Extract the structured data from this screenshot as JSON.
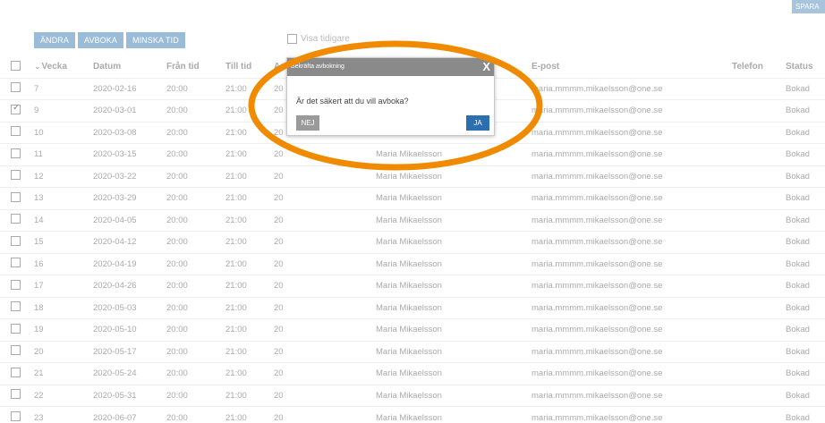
{
  "top_button": "SPARA",
  "toolbar": {
    "change": "ÄNDRA",
    "cancel": "AVBOKA",
    "reduce": "MINSKA TID"
  },
  "show_checkbox": {
    "label": "Visa tidigare"
  },
  "columns": {
    "vecka": "Vecka",
    "datum": "Datum",
    "fran": "Från tid",
    "till": "Till tid",
    "antal": "Ant",
    "namn": "",
    "epost": "E-post",
    "telefon": "Telefon",
    "status": "Status"
  },
  "rows": [
    {
      "vecka": "7",
      "datum": "2020-02-16",
      "fran": "20:00",
      "till": "21:00",
      "antal": "20",
      "namn": "",
      "epost": "maria.mmmm.mikaelsson@one.se",
      "status": "Bokad",
      "checked": false
    },
    {
      "vecka": "9",
      "datum": "2020-03-01",
      "fran": "20:00",
      "till": "21:00",
      "antal": "20",
      "namn": "",
      "epost": "maria.mmmm.mikaelsson@one.se",
      "status": "Bokad",
      "checked": true
    },
    {
      "vecka": "10",
      "datum": "2020-03-08",
      "fran": "20:00",
      "till": "21:00",
      "antal": "20",
      "namn": "",
      "epost": "maria.mmmm.mikaelsson@one.se",
      "status": "Bokad",
      "checked": false
    },
    {
      "vecka": "11",
      "datum": "2020-03-15",
      "fran": "20:00",
      "till": "21:00",
      "antal": "20",
      "namn": "Maria Mikaelsson",
      "epost": "maria.mmmm.mikaelsson@one.se",
      "status": "Bokad",
      "checked": false
    },
    {
      "vecka": "12",
      "datum": "2020-03-22",
      "fran": "20:00",
      "till": "21:00",
      "antal": "20",
      "namn": "Maria Mikaelsson",
      "epost": "maria.mmmm.mikaelsson@one.se",
      "status": "Bokad",
      "checked": false
    },
    {
      "vecka": "13",
      "datum": "2020-03-29",
      "fran": "20:00",
      "till": "21:00",
      "antal": "20",
      "namn": "Maria Mikaelsson",
      "epost": "maria.mmmm.mikaelsson@one.se",
      "status": "Bokad",
      "checked": false
    },
    {
      "vecka": "14",
      "datum": "2020-04-05",
      "fran": "20:00",
      "till": "21:00",
      "antal": "20",
      "namn": "Maria Mikaelsson",
      "epost": "maria.mmmm.mikaelsson@one.se",
      "status": "Bokad",
      "checked": false
    },
    {
      "vecka": "15",
      "datum": "2020-04-12",
      "fran": "20:00",
      "till": "21:00",
      "antal": "20",
      "namn": "Maria Mikaelsson",
      "epost": "maria.mmmm.mikaelsson@one.se",
      "status": "Bokad",
      "checked": false
    },
    {
      "vecka": "16",
      "datum": "2020-04-19",
      "fran": "20:00",
      "till": "21:00",
      "antal": "20",
      "namn": "Maria Mikaelsson",
      "epost": "maria.mmmm.mikaelsson@one.se",
      "status": "Bokad",
      "checked": false
    },
    {
      "vecka": "17",
      "datum": "2020-04-26",
      "fran": "20:00",
      "till": "21:00",
      "antal": "20",
      "namn": "Maria Mikaelsson",
      "epost": "maria.mmmm.mikaelsson@one.se",
      "status": "Bokad",
      "checked": false
    },
    {
      "vecka": "18",
      "datum": "2020-05-03",
      "fran": "20:00",
      "till": "21:00",
      "antal": "20",
      "namn": "Maria Mikaelsson",
      "epost": "maria.mmmm.mikaelsson@one.se",
      "status": "Bokad",
      "checked": false
    },
    {
      "vecka": "19",
      "datum": "2020-05-10",
      "fran": "20:00",
      "till": "21:00",
      "antal": "20",
      "namn": "Maria Mikaelsson",
      "epost": "maria.mmmm.mikaelsson@one.se",
      "status": "Bokad",
      "checked": false
    },
    {
      "vecka": "20",
      "datum": "2020-05-17",
      "fran": "20:00",
      "till": "21:00",
      "antal": "20",
      "namn": "Maria Mikaelsson",
      "epost": "maria.mmmm.mikaelsson@one.se",
      "status": "Bokad",
      "checked": false
    },
    {
      "vecka": "21",
      "datum": "2020-05-24",
      "fran": "20:00",
      "till": "21:00",
      "antal": "20",
      "namn": "Maria Mikaelsson",
      "epost": "maria.mmmm.mikaelsson@one.se",
      "status": "Bokad",
      "checked": false
    },
    {
      "vecka": "22",
      "datum": "2020-05-31",
      "fran": "20:00",
      "till": "21:00",
      "antal": "20",
      "namn": "Maria Mikaelsson",
      "epost": "maria.mmmm.mikaelsson@one.se",
      "status": "Bokad",
      "checked": false
    },
    {
      "vecka": "23",
      "datum": "2020-06-07",
      "fran": "20:00",
      "till": "21:00",
      "antal": "20",
      "namn": "Maria Mikaelsson",
      "epost": "maria.mmmm.mikaelsson@one.se",
      "status": "Bokad",
      "checked": false
    }
  ],
  "dialog": {
    "title": "Bekräfta avbokning",
    "close": "X",
    "message": "Är det säkert att du vill avboka?",
    "no": "NEJ",
    "yes": "JA"
  },
  "colors": {
    "accent": "#9bbcd8",
    "primary": "#2c6fb0",
    "highlight": "#f08a00"
  },
  "icons": {
    "sort": "chevron-down-icon",
    "close": "close-icon",
    "checkbox": "checkbox-icon"
  }
}
